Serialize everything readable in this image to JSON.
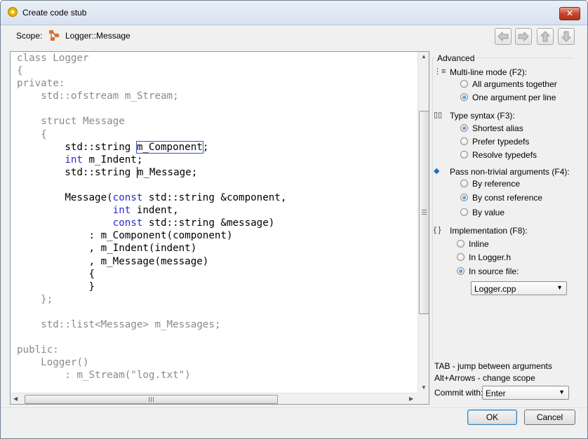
{
  "window": {
    "title": "Create code stub",
    "close_glyph": "✕"
  },
  "scope": {
    "label": "Scope:",
    "value": "Logger::Message",
    "icon": "class-scope-icon"
  },
  "nav_buttons": [
    "arrow-left-icon",
    "arrow-right-icon",
    "arrow-up-icon",
    "arrow-down-icon"
  ],
  "code_lines": [
    "class Logger",
    "{",
    "private:",
    "    std::ofstream m_Stream;",
    "",
    "    struct Message",
    "    {",
    "        std::string m_Component;",
    "        int m_Indent;",
    "        std::string m_Message;",
    "",
    "        Message(const std::string &component,",
    "                int indent,",
    "                const std::string &message)",
    "            : m_Component(component)",
    "            , m_Indent(indent)",
    "            , m_Message(message)",
    "            {",
    "            }",
    "    };",
    "",
    "    std::list<Message> m_Messages;",
    "",
    "public:",
    "    Logger()",
    "        : m_Stream(\"log.txt\")"
  ],
  "panel": {
    "group_label": "Advanced",
    "multiline": {
      "label": "Multi-line mode (F2):",
      "options": [
        "All arguments together",
        "One argument per line"
      ],
      "selected": 1
    },
    "type_syntax": {
      "label": "Type syntax (F3):",
      "options": [
        "Shortest alias",
        "Prefer typedefs",
        "Resolve typedefs"
      ],
      "selected": 0
    },
    "pass_args": {
      "label": "Pass non-trivial arguments (F4):",
      "options": [
        "By reference",
        "By const reference",
        "By value"
      ],
      "selected": 1
    },
    "implementation": {
      "label": "Implementation (F8):",
      "options": [
        "Inline",
        "In Logger.h",
        "In source file:"
      ],
      "selected": 2,
      "source_file": "Logger.cpp"
    },
    "hints": [
      "TAB - jump between arguments",
      "Alt+Arrows - change scope"
    ],
    "commit_label": "Commit with:",
    "commit_value": "Enter"
  },
  "buttons": {
    "ok": "OK",
    "cancel": "Cancel"
  }
}
